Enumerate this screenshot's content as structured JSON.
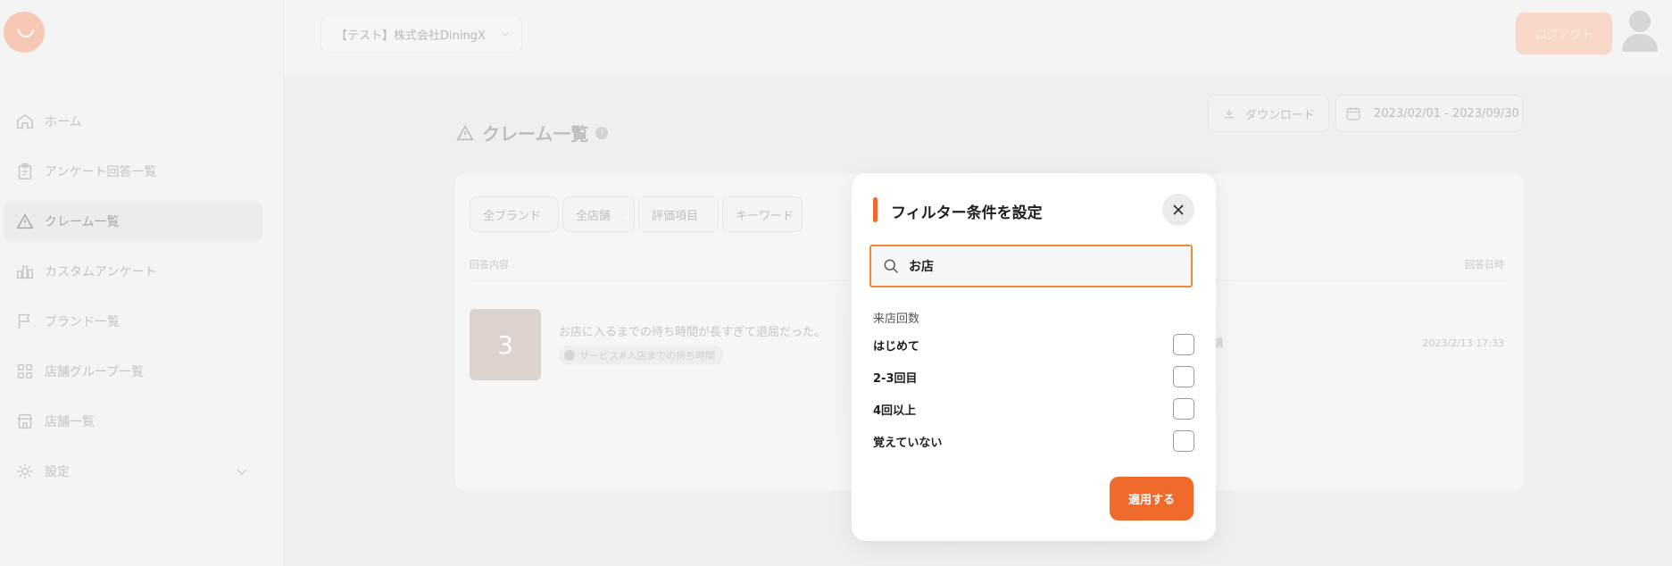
{
  "sidebar": {
    "logo_icon": "smile-logo-icon",
    "items": [
      {
        "label": "ホーム",
        "icon": "home-icon"
      },
      {
        "label": "アンケート回答一覧",
        "icon": "clipboard-icon"
      },
      {
        "label": "クレーム一覧",
        "icon": "warning-icon",
        "active": true
      },
      {
        "label": "カスタムアンケート",
        "icon": "bar-chart-icon"
      },
      {
        "label": "ブランド一覧",
        "icon": "flag-icon"
      },
      {
        "label": "店舗グループ一覧",
        "icon": "grid-icon"
      },
      {
        "label": "店舗一覧",
        "icon": "store-icon"
      },
      {
        "label": "設定",
        "icon": "gear-icon",
        "expandable": true
      }
    ]
  },
  "header": {
    "org_select": "【テスト】株式会社DiningX",
    "logout_label": "ログアウト"
  },
  "main": {
    "title": "クレーム一覧",
    "download_label": "ダウンロード",
    "date_range": "2023/02/01 - 2023/09/30",
    "filters": [
      "全ブランド",
      "全店舗",
      "評価項目",
      "キーワード"
    ],
    "columns": {
      "content": "回答内容",
      "date": "回答日時"
    },
    "rows": [
      {
        "score": "3",
        "comment": "お店に入るまでの待ち時間が長すぎて退屈だった。",
        "tag": "サービス#入店までの待ち時間",
        "store": "舗",
        "date": "2023/2/13 17:33"
      }
    ]
  },
  "modal": {
    "title": "フィルター条件を設定",
    "search_value": "お店",
    "section_label": "来店回数",
    "options": [
      "はじめて",
      "2-3回目",
      "4回以上",
      "覚えていない"
    ],
    "apply_label": "適用する"
  },
  "colors": {
    "accent": "#f06a2c",
    "search_border": "#f08a36"
  }
}
